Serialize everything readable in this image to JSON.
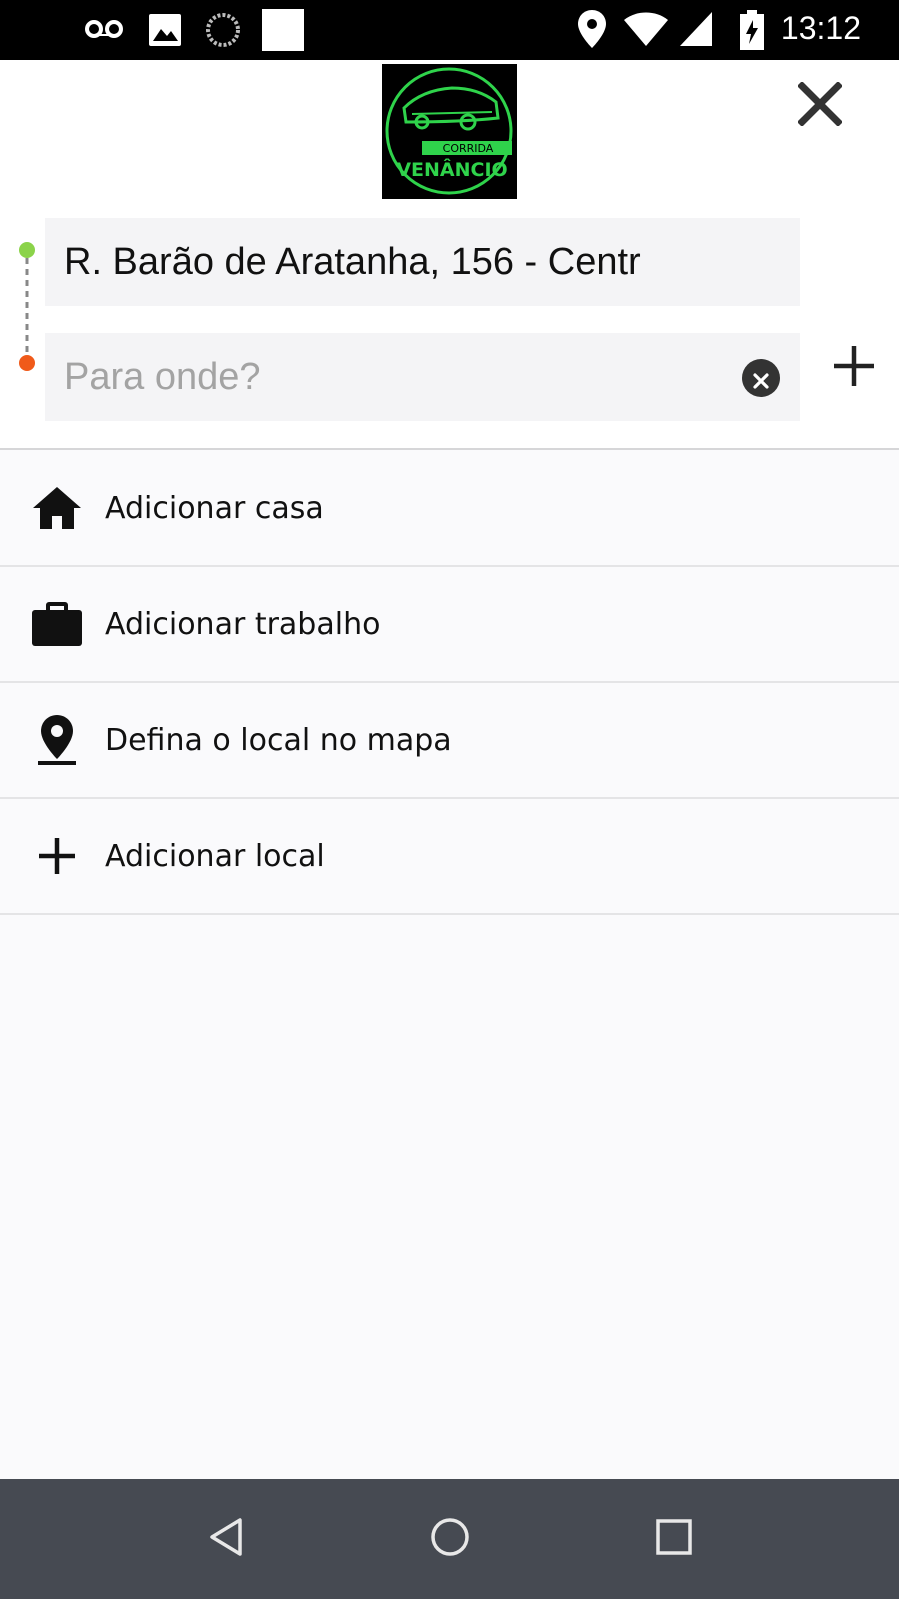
{
  "status_bar": {
    "time": "13:12"
  },
  "header": {
    "logo": {
      "line1": "CORRIDA",
      "line2": "VENÂNCIO",
      "brand_color": "#2fd34b"
    },
    "origin": {
      "value": "R. Barão de Aratanha, 156 - Centr",
      "dot_color": "#8bd34a"
    },
    "destination": {
      "placeholder": "Para onde?",
      "value": "",
      "dot_color": "#f05a1a"
    }
  },
  "list": {
    "items": [
      {
        "label": "Adicionar casa",
        "icon": "home-icon"
      },
      {
        "label": "Adicionar trabalho",
        "icon": "briefcase-icon"
      },
      {
        "label": "Defina o local no mapa",
        "icon": "map-pin-icon"
      },
      {
        "label": "Adicionar local",
        "icon": "plus-icon"
      }
    ]
  }
}
